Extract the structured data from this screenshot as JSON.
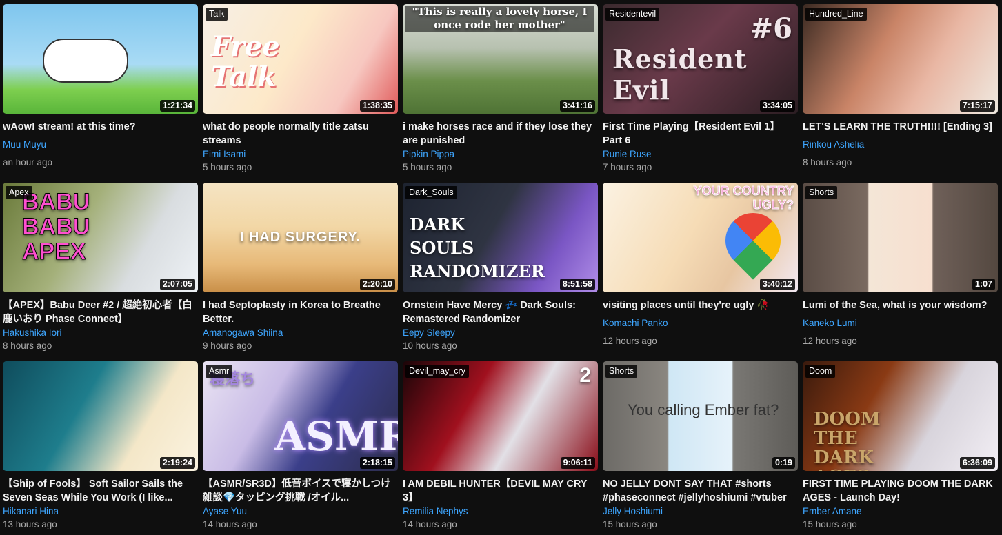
{
  "videos": [
    {
      "tag": "",
      "duration": "1:21:34",
      "title": "wAow! stream! at this time?",
      "channel": "Muu Muyu",
      "ago": "an hour ago",
      "bg": "linear-gradient(180deg,#7fc6ee 0%,#a9dbf5 55%,#7ecf4f 78%,#59b53a 100%)",
      "art": "cow"
    },
    {
      "tag": "Talk",
      "duration": "1:38:35",
      "title": "what do people normally title zatsu streams",
      "channel": "Eimi Isami",
      "ago": "5 hours ago",
      "bg": "linear-gradient(120deg,#f6efe6 0%,#fde9c9 45%,#f7c7c0 75%,#e05a5a 100%)",
      "art": "freetalk",
      "art_text": "Free Talk"
    },
    {
      "tag": "",
      "duration": "3:41:16",
      "title": "i make horses race and if they lose they are punished",
      "channel": "Pipkin Pippa",
      "ago": "5 hours ago",
      "bg": "linear-gradient(180deg,#d8dcd4 0%,#b7c1b0 40%,#6b8f4a 70%,#4f7335 100%)",
      "art": "horse",
      "art_text": "\"This is really a lovely horse, I once rode her mother\""
    },
    {
      "tag": "Residentevil",
      "duration": "3:34:05",
      "title": "First Time Playing【Resident Evil 1】Part 6",
      "channel": "Runie Ruse",
      "ago": "7 hours ago",
      "bg": "linear-gradient(135deg,#3a2a2e 0%,#6a3a4a 45%,#2b1d22 100%)",
      "art": "re",
      "art_text": "Resident Evil",
      "art_num": "#6"
    },
    {
      "tag": "Hundred_Line",
      "duration": "7:15:17",
      "title": "LET'S LEARN THE TRUTH!!!! [Ending 3]",
      "channel": "Rinkou Ashelia",
      "ago": "8 hours ago",
      "bg": "linear-gradient(120deg,#3b2a22 0%,#c98467 40%,#e9b7a4 65%,#efe9e0 100%)",
      "art": "hundred"
    },
    {
      "tag": "Apex",
      "duration": "2:07:05",
      "title": "【APEX】Babu Deer #2 / 超絶初心者【白鹿いおり Phase Connect】",
      "channel": "Hakushika Iori",
      "ago": "8 hours ago",
      "bg": "linear-gradient(120deg,#6a7a3a 0%,#a4b07a 40%,#d9dde0 70%,#eef2f6 100%)",
      "art": "apex",
      "art_text": "BABU BABU APEX"
    },
    {
      "tag": "",
      "duration": "2:20:10",
      "title": "I had Septoplasty in Korea to Breathe Better.",
      "channel": "Amanogawa Shiina",
      "ago": "9 hours ago",
      "bg": "linear-gradient(180deg,#f5e4c3 0%,#f2d7a6 40%,#e7b978 75%,#c98f48 100%)",
      "art": "surgery",
      "art_text": "I HAD SURGERY."
    },
    {
      "tag": "Dark_Souls",
      "duration": "8:51:58",
      "title": "Ornstein Have Mercy 💤 Dark Souls: Remastered Randomizer",
      "channel": "Eepy Sleepy",
      "ago": "10 hours ago",
      "bg": "linear-gradient(120deg,#1d2330 0%,#2f3442 45%,#7a56c4 75%,#b08de8 100%)",
      "art": "ds",
      "art_text": "DARK SOULS RANDOMIZER"
    },
    {
      "tag": "",
      "duration": "3:40:12",
      "title": "visiting places until they're ugly 🥀",
      "channel": "Komachi Panko",
      "ago": "12 hours ago",
      "bg": "linear-gradient(120deg,#fbf2e2 0%,#f6dcb6 45%,#e7c6a2 70%,#f3e9f2 100%)",
      "art": "maps",
      "art_text": "YOUR COUNTRY UGLY?"
    },
    {
      "tag": "Shorts",
      "duration": "1:07",
      "title": "Lumi of the Sea, what is your wisdom?",
      "channel": "Kaneko Lumi",
      "ago": "12 hours ago",
      "bg": "linear-gradient(90deg,#5a4c45 0%,#7a6a60 33%,#f4e6d7 34%,#f7dfcf 66%,#6f6059 67%,#544840 100%)",
      "art": "shorts"
    },
    {
      "tag": "",
      "duration": "2:19:24",
      "title": "【Ship of Fools】 Soft Sailor Sails the Seven Seas While You Work (I like...",
      "channel": "Hikanari Hina",
      "ago": "13 hours ago",
      "bg": "linear-gradient(120deg,#0f4c5c 0%,#1e7d8c 40%,#f4e7c8 70%,#fbf3e0 100%)",
      "art": "ship"
    },
    {
      "tag": "Asmr",
      "duration": "2:18:15",
      "title": "【ASMR/SR3D】低音ボイスで寝かしつけ雑談💎タッピング挑戦 /オイル...",
      "channel": "Ayase Yuu",
      "ago": "14 hours ago",
      "bg": "linear-gradient(120deg,#e9e3f3 0%,#c9bce6 35%,#3b3f8a 60%,#2c2c4a 100%)",
      "art": "asmr",
      "art_text": "ASMR",
      "art_jp": "寝落ち"
    },
    {
      "tag": "Devil_may_cry",
      "duration": "9:06:11",
      "title": "I AM DEBIL HUNTER【DEVIL MAY CRY 3】",
      "channel": "Remilia Nephys",
      "ago": "14 hours ago",
      "bg": "linear-gradient(120deg,#1a0508 0%,#a0101e 35%,#e2e0e6 60%,#8a0c18 100%)",
      "art": "dmc",
      "art_num": "2"
    },
    {
      "tag": "Shorts",
      "duration": "0:19",
      "title": "NO JELLY DONT SAY THAT #shorts #phaseconnect #jellyhoshiumi #vtuber",
      "channel": "Jelly Hoshiumi",
      "ago": "15 hours ago",
      "bg": "linear-gradient(90deg,#6c6a66 0%,#8a8680 33%,#cfe7f5 34%,#e6f2fa 66%,#7a7874 67%,#5e5c58 100%)",
      "art": "jelly",
      "art_text": "You calling Ember fat?"
    },
    {
      "tag": "Doom",
      "duration": "6:36:09",
      "title": "FIRST TIME PLAYING DOOM THE DARK AGES - Launch Day!",
      "channel": "Ember Amane",
      "ago": "15 hours ago",
      "bg": "linear-gradient(120deg,#3a1a0d 0%,#8a3a14 35%,#d8d4dc 65%,#f2eef4 100%)",
      "art": "doom",
      "art_text": "DOOM THE DARK AGES"
    }
  ]
}
